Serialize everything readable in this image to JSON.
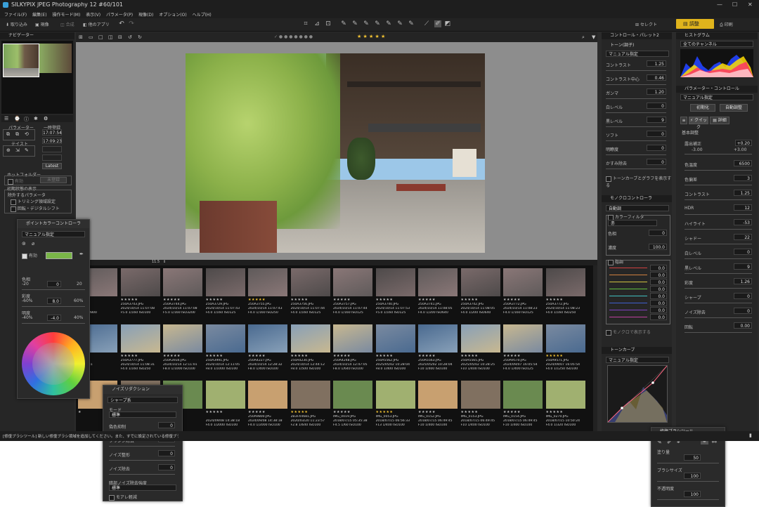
{
  "app": {
    "title": "SILKYPIX JPEG Photography 12    #60/101"
  },
  "menu": [
    "ファイル(F)",
    "編集(E)",
    "操作モード(M)",
    "表示(V)",
    "パラメータ(P)",
    "現像(D)",
    "オプション(O)",
    "ヘルプ(H)"
  ],
  "toolbar": {
    "items": [
      "取り込み",
      "現像",
      "合成",
      "他のアプリ"
    ],
    "select_label": "セレクト",
    "adjust_label": "調整",
    "print_label": "印刷"
  },
  "navigator": {
    "title": "ナビゲーター"
  },
  "left_panel": {
    "param_label": "パラメーター",
    "taste_label": "テイスト",
    "history_label": "一時登録",
    "times": [
      "17:07:54",
      "17:09:23"
    ],
    "latest": "Latest",
    "hotfolder_label": "ホットフォルダー",
    "effective": "有効",
    "unregistered": "未登録",
    "initial_label": "初期状態の表示",
    "exclude_label": "除外するパラメータ",
    "check1": "トリミング領域設定",
    "check2": "回転・デジタルシフト"
  },
  "viewer": {
    "zoom": "11.5"
  },
  "filmstrip": {
    "row1": [
      {
        "name": "",
        "date": "",
        "exif": "100 ISO800",
        "stars": "★★★"
      },
      {
        "name": "250A3743.JPG",
        "date": "2024/10/14 11:07:08",
        "exif": "F5.0 1/160 ISO100",
        "stars": "★★★★★"
      },
      {
        "name": "250A3744.JPG",
        "date": "2024/10/14 11:07:08",
        "exif": "F5.0 1/160 ISO3200",
        "stars": "★★★★★"
      },
      {
        "name": "250A3729.JPG",
        "date": "2024/10/14 11:07:43",
        "exif": "F4.0 1/160 ISO125",
        "stars": "★★★★★"
      },
      {
        "name": "250A3755.JPG",
        "date": "2024/10/14 11:07:43",
        "exif": "F4.0 1/160 ISO250",
        "stars": "★★★★★"
      },
      {
        "name": "250A3756.JPG",
        "date": "2024/10/14 11:07:44",
        "exif": "F4.0 1/160 ISO125",
        "stars": "★★★★★"
      },
      {
        "name": "250A3757.JPG",
        "date": "2024/10/14 11:07:44",
        "exif": "F4.0 1/160 ISO125",
        "stars": "★★★★★"
      },
      {
        "name": "250A3740.JPG",
        "date": "2024/10/14 11:07:53",
        "exif": "F5.0 1/160 ISO125",
        "stars": "★★★★★"
      },
      {
        "name": "250A3741.JPG",
        "date": "2024/10/14 11:08:05",
        "exif": "F4.0 1/200 ISO640",
        "stars": "★★★★★"
      },
      {
        "name": "250A3742.JPG",
        "date": "2024/10/14 11:08:05",
        "exif": "F4.0 1/200 ISO640",
        "stars": "★★★★★"
      },
      {
        "name": "250A3772.JPG",
        "date": "2024/10/14 11:08:23",
        "exif": "F4.0 1/160 ISO125",
        "stars": "★★★★★"
      },
      {
        "name": "250A3772.JPG",
        "date": "2024/10/14 11:08:23",
        "exif": "F4.0 1/160 ISO250",
        "stars": "★★★★★"
      }
    ],
    "row2": [
      {
        "name": "6.JPG",
        "date": "11:08:31",
        "exif": "ISO250",
        "stars": "★★★"
      },
      {
        "name": "250A3777.JPG",
        "date": "2024/10/14 11:08:31",
        "exif": "F4.0 1/160 ISO250",
        "stars": "★★★★★"
      },
      {
        "name": "250A3934.JPG",
        "date": "2024/10/14 12:11:01",
        "exif": "F8.0 1/1000 ISO100",
        "stars": "★★★★★"
      },
      {
        "name": "250A3991.JPG",
        "date": "2024/10/14 12:11:05",
        "exif": "F8.0 1/1000 ISO100",
        "stars": "★★★★★"
      },
      {
        "name": "250A4227.JPG",
        "date": "2024/10/14 12:28:32",
        "exif": "F8.0 1/400 ISO100",
        "stars": "★★★★★"
      },
      {
        "name": "250A4230.JPG",
        "date": "2024/10/14 12:44:12",
        "exif": "F8.0 1/500 ISO100",
        "stars": "★★★★★"
      },
      {
        "name": "250A4248.JPG",
        "date": "2024/10/14 12:47:05",
        "exif": "F8.0 1/640 ISO100",
        "stars": "★★★★★"
      },
      {
        "name": "250A5562.JPG",
        "date": "2025/05/02 10:28:04",
        "exif": "F8.0 1/400 ISO100",
        "stars": "★★★★★"
      },
      {
        "name": "250A5563.JPG",
        "date": "2025/05/02 10:28:04",
        "exif": "F10 1/400 ISO100",
        "stars": "★★★★★"
      },
      {
        "name": "250A5565.JPG",
        "date": "2025/05/02 10:28:25",
        "exif": "F10 1/400 ISO100",
        "stars": "★★★★★"
      },
      {
        "name": "250A9570.JPG",
        "date": "2024/09/07 16:05:54",
        "exif": "F4.0 1/400 ISO125",
        "stars": "★★★★★"
      },
      {
        "name": "250A9571.JPG",
        "date": "2024/09/07 16:05:54",
        "exif": "F4.0 1/1250 ISO100",
        "stars": "★★★★★"
      }
    ],
    "row3": [
      {
        "name": "",
        "date": "",
        "exif": "",
        "stars": "★"
      },
      {
        "name": "",
        "date": "",
        "exif": "",
        "stars": ""
      },
      {
        "name": "",
        "date": "",
        "exif": "",
        "stars": ""
      },
      {
        "name": "",
        "date": "2024/09/08 14:38:18",
        "exif": "F4.0 1/2000 ISO100",
        "stars": "★★★★★"
      },
      {
        "name": "250A9800.JPG",
        "date": "2024/09/08 14:38:18",
        "exif": "F4.0 1/2000 ISO100",
        "stars": "★★★★★"
      },
      {
        "name": "2B3FX4681.JPG",
        "date": "2020/03/20 11:23:57",
        "exif": "F2.8 1/640 ISO100",
        "stars": "★★★★★"
      },
      {
        "name": "IMG_0019.JPG",
        "date": "2018/07/15 05:35:38",
        "exif": "F4.5 1/60 ISO100",
        "stars": "★★★★★"
      },
      {
        "name": "IMG_0053.JPG",
        "date": "2018/07/15 06:56:33",
        "exif": "F13 1/400 ISO100",
        "stars": "★★★★★"
      },
      {
        "name": "IMG_0152.JPG",
        "date": "2018/07/15 06:49:45",
        "exif": "F10 1/400 ISO100",
        "stars": "★★★★★"
      },
      {
        "name": "IMG_0153.JPG",
        "date": "2018/07/15 06:49:45",
        "exif": "F10 1/400 ISO100",
        "stars": "★★★★★"
      },
      {
        "name": "IMG_0154.JPG",
        "date": "2018/07/15 06:49:45",
        "exif": "F10 1/400 ISO100",
        "stars": "★★★★★"
      },
      {
        "name": "IMG_0270.JPG",
        "date": "2018/07/15 10:50:24",
        "exif": "F4.0 1/320 ISO100",
        "stars": "★★★★★"
      }
    ]
  },
  "tone_panel": {
    "header": "コントロール・パレット2",
    "title": "トーン(調子)",
    "preset": "マニュアル指定",
    "rows": [
      {
        "label": "コントラスト",
        "value": "1.25"
      },
      {
        "label": "コントラスト中心",
        "value": "0.46"
      },
      {
        "label": "ガンマ",
        "value": "1.20"
      },
      {
        "label": "白レベル",
        "value": "0"
      },
      {
        "label": "黒レベル",
        "value": "9"
      },
      {
        "label": "ソフト",
        "value": "0"
      },
      {
        "label": "明瞭度",
        "value": "0"
      },
      {
        "label": "かすみ除去",
        "value": "0"
      }
    ],
    "curve_check": "トーンカーブとグラフを表示する"
  },
  "mono_panel": {
    "title": "モノクロコントローラ",
    "mode": "自動調",
    "color_filter": "カラーフィルタ",
    "filter_value": "赤",
    "rows": [
      {
        "label": "色相",
        "value": "0"
      },
      {
        "label": "濃度",
        "value": "100.0"
      }
    ],
    "hue_label": "階調",
    "values": [
      "0.0",
      "0.0",
      "0.0",
      "0.0",
      "0.0",
      "0.0",
      "0.0",
      "0.0"
    ],
    "show_check": "モノクロで表示する"
  },
  "curve_panel": {
    "title": "トーンカーブ",
    "preset": "マニュアル指定"
  },
  "histogram": {
    "title": "ヒストグラム",
    "channel": "全てのチャンネル"
  },
  "param_panel": {
    "title": "パラメーター・コントロール",
    "preset": "マニュアル指定",
    "btn_init": "初期化",
    "btn_auto": "自動調整",
    "tab_quick": "クイック",
    "tab_detail": "詳細",
    "basic_label": "基本調整",
    "exposure_label": "露出補正",
    "exposure_value": "+0.20",
    "range_min": "-3.00",
    "range_max": "+3.00",
    "rows": [
      {
        "label": "色温度",
        "value": "6500"
      },
      {
        "label": "色偏差",
        "value": "3"
      },
      {
        "label": "コントラスト",
        "value": "1.25"
      },
      {
        "label": "HDR",
        "value": "12"
      },
      {
        "label": "ハイライト",
        "value": "-53"
      },
      {
        "label": "シャドー",
        "value": "22"
      },
      {
        "label": "白レベル",
        "value": "0"
      },
      {
        "label": "黒レベル",
        "value": "9"
      },
      {
        "label": "彩度",
        "value": "1.26"
      },
      {
        "label": "シャープ",
        "value": "0"
      },
      {
        "label": "ノイズ除去",
        "value": "0"
      },
      {
        "label": "回転",
        "value": "0.00"
      }
    ]
  },
  "pointcolor": {
    "title": "ポイントカラーコントローラ",
    "preset": "マニュアル指定",
    "enabled_label": "有効",
    "hue_label": "色相",
    "hue_min": "-20",
    "hue_max": "20",
    "hue_value": "0",
    "sat_label": "彩度",
    "sat_min": "-60%",
    "sat_max": "60%",
    "sat_value": "8.0",
    "light_label": "明度",
    "light_min": "-40%",
    "light_max": "40%",
    "light_value": "-4.0"
  },
  "noise_panel": {
    "title": "ノイズリダクション",
    "preset": "シャープ系",
    "mode_label": "モード",
    "mode_value": "標準",
    "rows": [
      {
        "label": "偽色抑制",
        "value": "0"
      },
      {
        "label": "フリンジ除去",
        "value": "0"
      },
      {
        "label": "ノイズ整形",
        "value": "0"
      },
      {
        "label": "ノイズ除去",
        "value": "0"
      }
    ],
    "dark_label": "暗部ノイズ除去強度",
    "dark_value": "標準",
    "moire_label": "モアレ軽減"
  },
  "brush_panel": {
    "title": "修復ブラシツール",
    "rows": [
      {
        "label": "塗り量",
        "value": "50"
      },
      {
        "label": "ブラシサイズ",
        "value": "100"
      },
      {
        "label": "不透明度",
        "value": "100"
      }
    ]
  },
  "statusbar": {
    "text": "[修復ブラシツール] 新しい修復ブラシ領域を追加してください。また、すでに設定されている修復ブラシ領域の位置を変更することができます。"
  },
  "colors": {
    "accent_gold": "#e0b41c",
    "star": "#f1c232"
  }
}
